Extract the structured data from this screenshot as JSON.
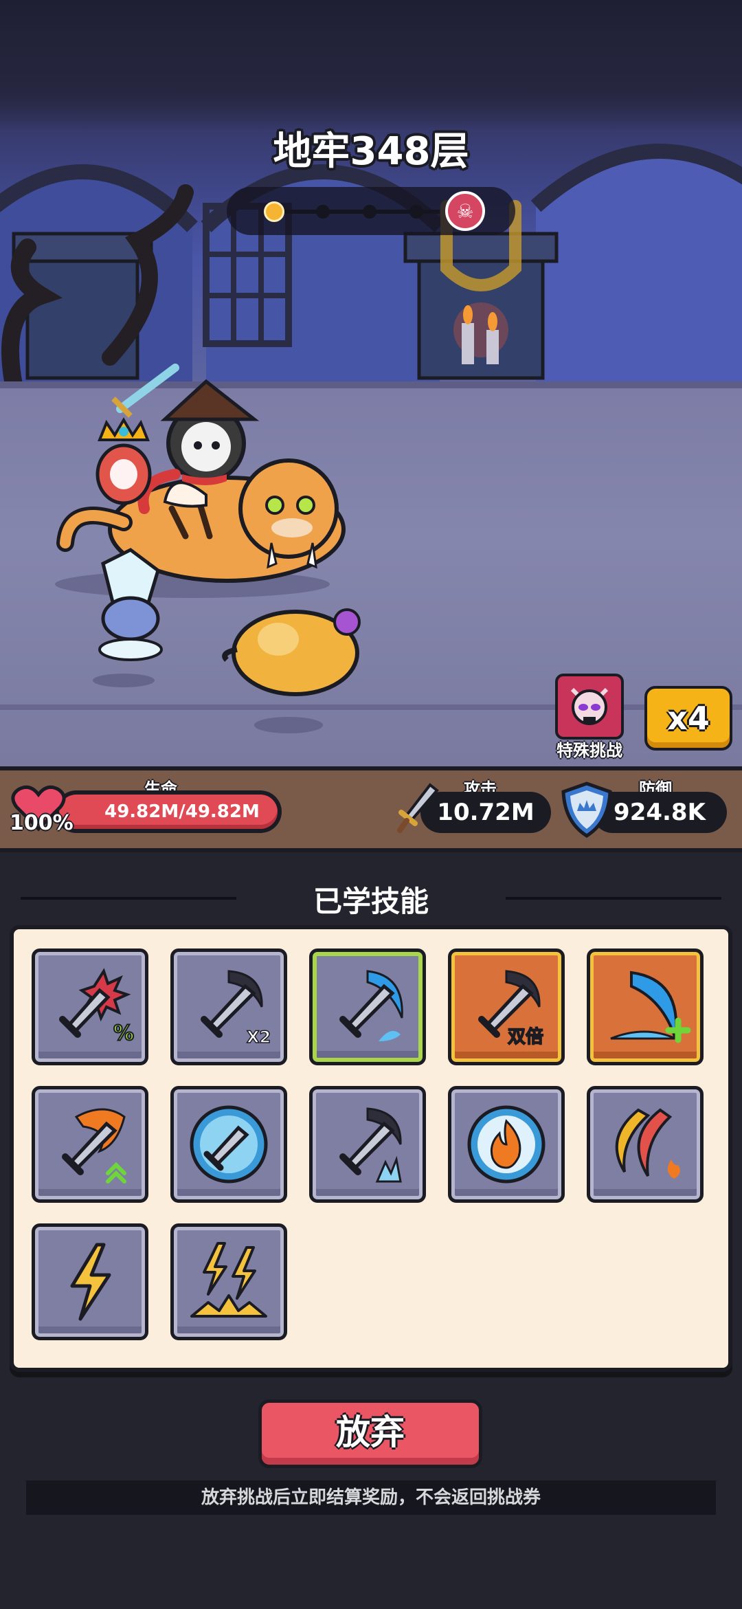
{
  "dungeon": {
    "title": "地牢348层",
    "progress_stage": 1,
    "progress_total": 5
  },
  "battle_controls": {
    "special_challenge_label": "特殊挑战",
    "speed_label": "x4"
  },
  "stats": {
    "hp_label": "生命",
    "hp_value": "49.82M/49.82M",
    "hp_percent_text": "100%",
    "hp_fraction": 1.0,
    "attack_label": "攻击",
    "attack_value": "10.72M",
    "defense_label": "防御",
    "defense_value": "924.8K"
  },
  "skills_section": {
    "title": "已学技能",
    "skills": [
      {
        "icon": "crit-sword-icon",
        "badge": "%"
      },
      {
        "icon": "double-slash-sword-icon",
        "badge": "X2"
      },
      {
        "icon": "blue-wave-sword-icon",
        "badge": ""
      },
      {
        "icon": "double-damage-sword-icon",
        "badge": "双倍"
      },
      {
        "icon": "blue-wave-plus-icon",
        "badge": "+"
      },
      {
        "icon": "fire-sword-icon",
        "badge": "^"
      },
      {
        "icon": "shield-sword-icon",
        "badge": ""
      },
      {
        "icon": "spike-sword-icon",
        "badge": ""
      },
      {
        "icon": "fire-orb-icon",
        "badge": ""
      },
      {
        "icon": "crescent-fire-icon",
        "badge": ""
      },
      {
        "icon": "lightning-icon",
        "badge": ""
      },
      {
        "icon": "double-lightning-icon",
        "badge": ""
      }
    ]
  },
  "actions": {
    "give_up_label": "放弃",
    "notice": "放弃挑战后立即结算奖励，不会返回挑战券"
  },
  "colors": {
    "accent_red": "#ea5664",
    "accent_gold": "#f5b318",
    "panel": "#fbeedd"
  }
}
